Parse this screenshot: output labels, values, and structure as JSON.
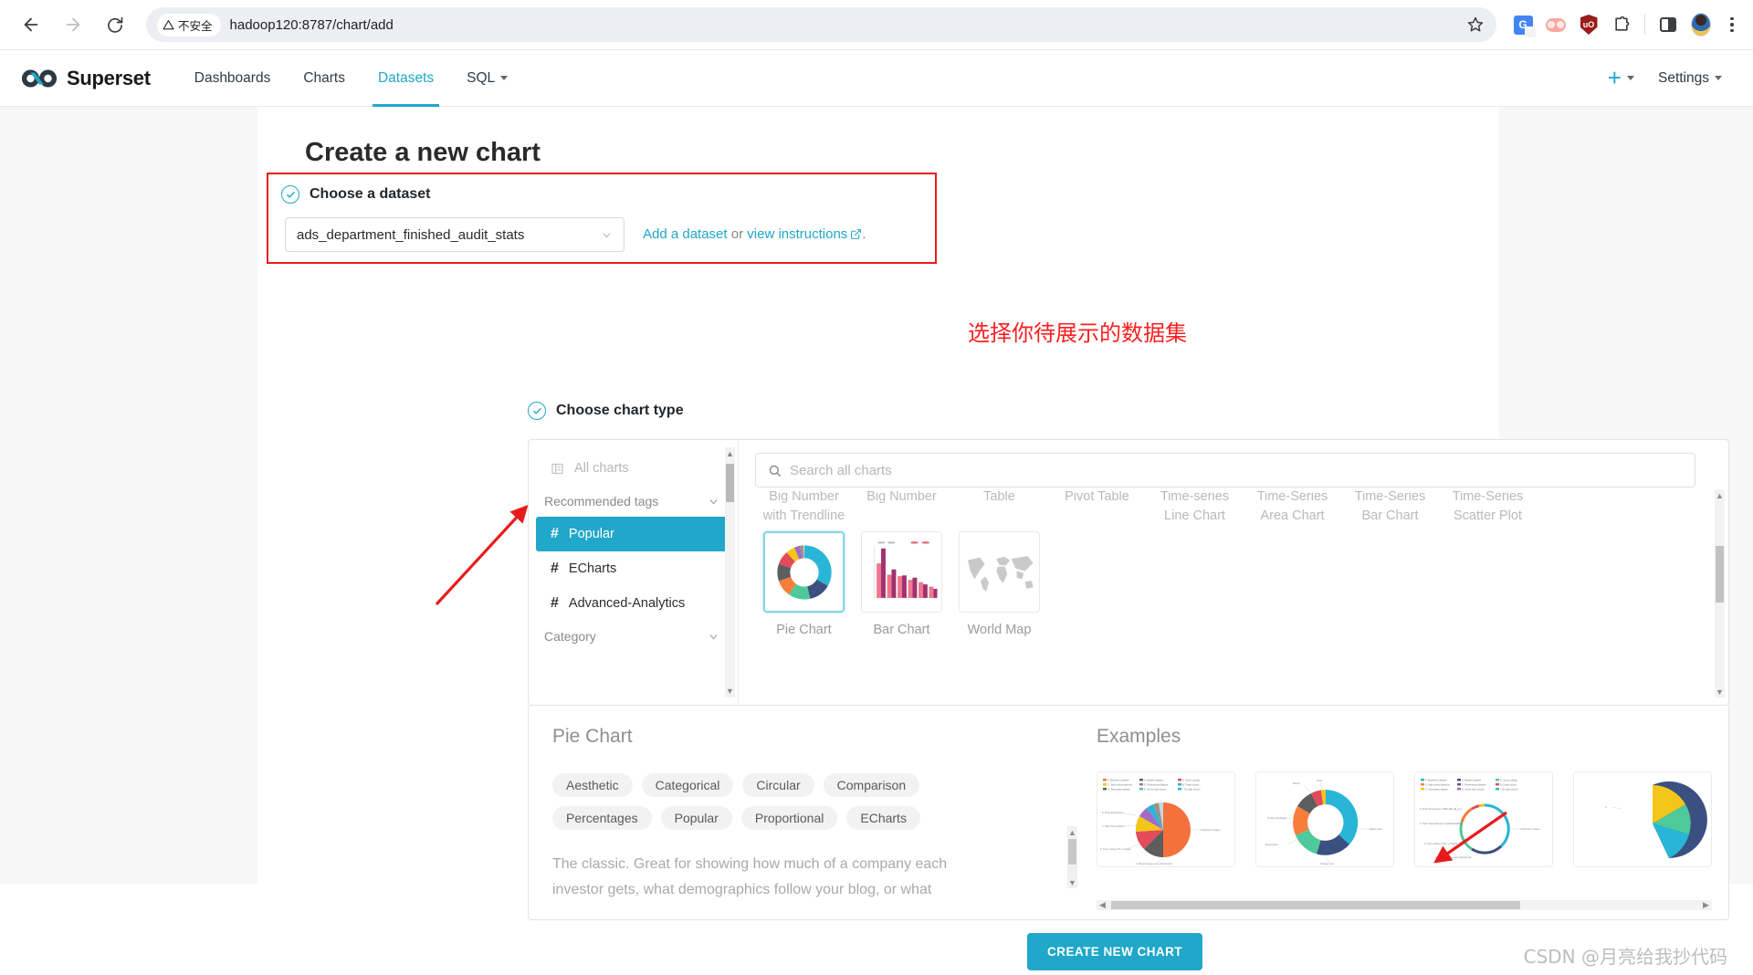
{
  "browser": {
    "back_icon": "back-arrow-icon",
    "forward_icon": "forward-arrow-icon",
    "reload_icon": "reload-icon",
    "security_label": "不安全",
    "url": "hadoop120:8787/chart/add",
    "bookmark_icon": "star-icon",
    "extensions": [
      {
        "name": "google-translate-extension",
        "glyph": "G"
      },
      {
        "name": "pink-extension",
        "glyph": ""
      },
      {
        "name": "ublock-origin-extension",
        "glyph": "uO"
      },
      {
        "name": "extensions-puzzle-icon",
        "glyph": ""
      },
      {
        "name": "side-panel-icon",
        "glyph": ""
      },
      {
        "name": "profile-avatar",
        "glyph": ""
      },
      {
        "name": "chrome-menu-icon",
        "glyph": ""
      }
    ]
  },
  "navbar": {
    "brand": "Superset",
    "items": [
      {
        "label": "Dashboards",
        "active": false
      },
      {
        "label": "Charts",
        "active": false
      },
      {
        "label": "Datasets",
        "active": true
      },
      {
        "label": "SQL",
        "active": false,
        "has_caret": true
      }
    ],
    "plus_label": "+",
    "settings_label": "Settings"
  },
  "page": {
    "title": "Create a new chart"
  },
  "dataset_step": {
    "label": "Choose a dataset",
    "selected": "ads_department_finished_audit_stats",
    "add_link": "Add a dataset",
    "or_text": " or ",
    "instructions_link": "view instructions",
    "trailing": "."
  },
  "annotations": {
    "dataset_note": "选择你待展示的数据集",
    "watermark": "CSDN @月亮给我抄代码"
  },
  "chart_type_step": {
    "label": "Choose chart type",
    "sidebar": {
      "all_charts": "All charts",
      "recommended_tags_group": "Recommended tags",
      "tags": [
        {
          "label": "Popular",
          "selected": true
        },
        {
          "label": "ECharts",
          "selected": false
        },
        {
          "label": "Advanced-Analytics",
          "selected": false
        }
      ],
      "category_group": "Category"
    },
    "search_placeholder": "Search all charts",
    "cut_off_labels": [
      "Big Number\nwith Trendline",
      "Big Number",
      "Table",
      "Pivot Table",
      "Time-series\nLine Chart",
      "Time-Series\nArea Chart",
      "Time-Series\nBar Chart",
      "Time-Series\nScatter Plot"
    ],
    "charts": [
      {
        "label": "Pie Chart",
        "selected": true,
        "thumb": "donut"
      },
      {
        "label": "Bar Chart",
        "selected": false,
        "thumb": "bars"
      },
      {
        "label": "World Map",
        "selected": false,
        "thumb": "map"
      }
    ]
  },
  "details": {
    "title": "Pie Chart",
    "tags": [
      "Aesthetic",
      "Categorical",
      "Circular",
      "Comparison",
      "Percentages",
      "Popular",
      "Proportional",
      "ECharts"
    ],
    "description": "The classic. Great for showing how much of a company each investor gets, what demographics follow your blog, or what portion of the budget goes to the military industrial complex. Pie",
    "examples_title": "Examples",
    "examples": [
      {
        "name": "example-pie-orange"
      },
      {
        "name": "example-donut"
      },
      {
        "name": "example-thin-ring"
      },
      {
        "name": "example-pie-navy"
      }
    ]
  },
  "footer": {
    "create_button": "CREATE NEW CHART"
  },
  "colors": {
    "accent": "#20a7c9",
    "annotation_red": "#fb2020",
    "highlight_border": "#e81b1b",
    "text_dark": "#2a2a2a",
    "text_muted": "#9b9b9b"
  }
}
